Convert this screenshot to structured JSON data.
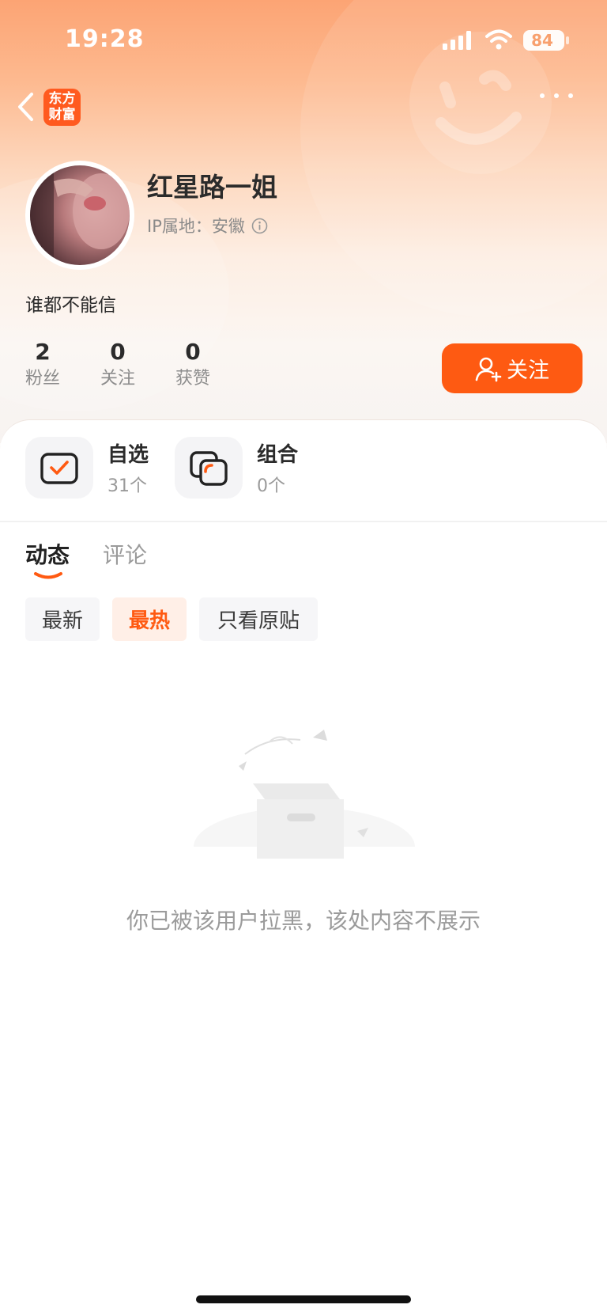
{
  "status_bar": {
    "time": "19:28",
    "battery": "84"
  },
  "nav": {
    "logo_line1": "东方",
    "logo_line2": "财富"
  },
  "profile": {
    "name": "红星路一姐",
    "ip_location": "IP属地：安徽",
    "bio": "谁都不能信",
    "stats": [
      {
        "value": "2",
        "label": "粉丝"
      },
      {
        "value": "0",
        "label": "关注"
      },
      {
        "value": "0",
        "label": "获赞"
      }
    ],
    "follow_label": "关注"
  },
  "quick": [
    {
      "title": "自选",
      "sub": "31个"
    },
    {
      "title": "组合",
      "sub": "0个"
    }
  ],
  "tabs": [
    {
      "label": "动态",
      "active": true
    },
    {
      "label": "评论",
      "active": false
    }
  ],
  "filters": [
    {
      "label": "最新",
      "active": false
    },
    {
      "label": "最热",
      "active": true
    },
    {
      "label": "只看原贴",
      "active": false
    }
  ],
  "empty_message": "你已被该用户拉黑，该处内容不展示",
  "colors": {
    "accent": "#fe5a12",
    "header_top": "#fca474"
  }
}
